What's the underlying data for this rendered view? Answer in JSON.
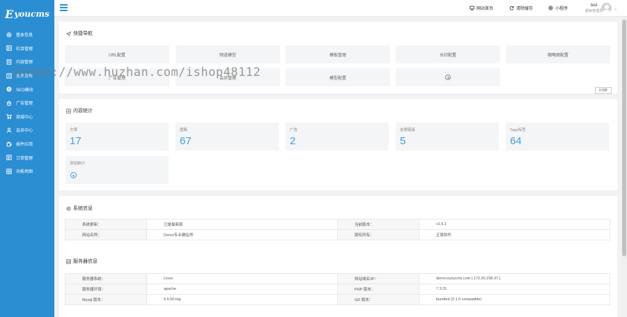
{
  "app": {
    "logo": "Eyoucms",
    "logo_e": "E",
    "logo_rest": "youcms"
  },
  "sidebar": {
    "items": [
      {
        "label": "基本信息",
        "icon": "gear-icon"
      },
      {
        "label": "栏目管理",
        "icon": "columns-icon"
      },
      {
        "label": "内容管理",
        "icon": "document-icon"
      },
      {
        "label": "允许发布",
        "icon": "list-icon"
      },
      {
        "label": "SEO模块",
        "icon": "globe-icon"
      },
      {
        "label": "广告管理",
        "icon": "home-icon"
      },
      {
        "label": "商城中心",
        "icon": "cart-icon"
      },
      {
        "label": "会员中心",
        "icon": "user-icon"
      },
      {
        "label": "插件应用",
        "icon": "puzzle-icon"
      },
      {
        "label": "订单管理",
        "icon": "order-icon"
      },
      {
        "label": "功能地图",
        "icon": "grid-icon"
      }
    ]
  },
  "topbar": {
    "links": [
      {
        "label": "网站首页",
        "icon": "monitor-icon"
      },
      {
        "label": "清除缓存",
        "icon": "refresh-icon"
      },
      {
        "label": "小程序",
        "icon": "miniapp-icon"
      }
    ],
    "user": {
      "name": "test",
      "role": "超级管理员"
    }
  },
  "quick_nav": {
    "title": "快捷导航",
    "tiles": [
      "URL配置",
      "频道模型",
      "模板管理",
      "水印配置",
      "缩略图配置",
      "广告管理",
      "会员管理",
      "模型配置"
    ],
    "hide_label": "0.5秒"
  },
  "content_stats": {
    "title": "内容统计",
    "tiles": [
      {
        "label": "文章",
        "value": "17"
      },
      {
        "label": "图集",
        "value": "67"
      },
      {
        "label": "广告",
        "value": "2"
      },
      {
        "label": "友情链接",
        "value": "5"
      },
      {
        "label": "Tags标签",
        "value": "64"
      }
    ],
    "add_label": "添加统计"
  },
  "system_info": {
    "title": "系统信息",
    "rows": [
      [
        "系统更新：",
        "已是最新版",
        "当前版本：",
        "v1.6.1"
      ],
      [
        "网站名称：",
        "Demo专业建站师",
        "版权所有：",
        "正版软件"
      ]
    ]
  },
  "server_info": {
    "title": "服务器信息",
    "rows": [
      [
        "服务器系统：",
        "Linux",
        "网站域名/IP：",
        "demo.eyoucms.com [ 172.20.238.37 ]"
      ],
      [
        "服务器环境：",
        "apache",
        "PHP 版本：",
        "7.3.31"
      ],
      [
        "Mysql 版本：",
        "5.6.50-log",
        "GD 版本：",
        "bundled (2.1.0 compatible)"
      ]
    ]
  },
  "watermark": "https://www.huzhan.com/ishop48112"
}
